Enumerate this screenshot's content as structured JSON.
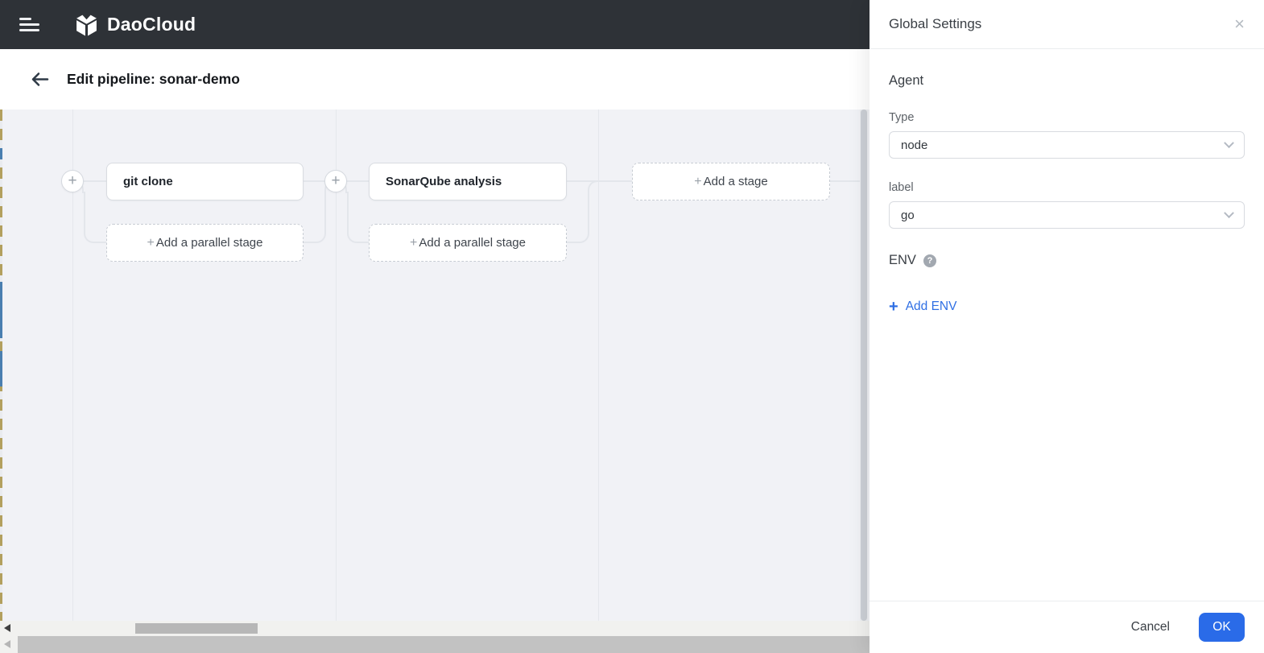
{
  "navbar": {
    "brand": "DaoCloud"
  },
  "header": {
    "title": "Edit pipeline: sonar-demo"
  },
  "glyphs": {
    "plus": "+",
    "close": "×",
    "help": "?"
  },
  "pipeline": {
    "stages": [
      {
        "label": "git clone",
        "add_parallel_label": "Add a parallel stage"
      },
      {
        "label": "SonarQube analysis",
        "add_parallel_label": "Add a parallel stage"
      }
    ],
    "add_stage_label": "Add a stage"
  },
  "panel": {
    "title": "Global Settings",
    "agent_section": "Agent",
    "type_field": {
      "label": "Type",
      "value": "node"
    },
    "label_field": {
      "label": "label",
      "value": "go"
    },
    "env_section": "ENV",
    "add_env_label": "Add ENV",
    "cancel_label": "Cancel",
    "ok_label": "OK"
  },
  "colors": {
    "navbar_bg": "#2e3237",
    "canvas_bg": "#f1f2f6",
    "connector": "#e3e6eb",
    "accent_blue": "#2a6be8",
    "link_blue": "#2f6fe4"
  }
}
